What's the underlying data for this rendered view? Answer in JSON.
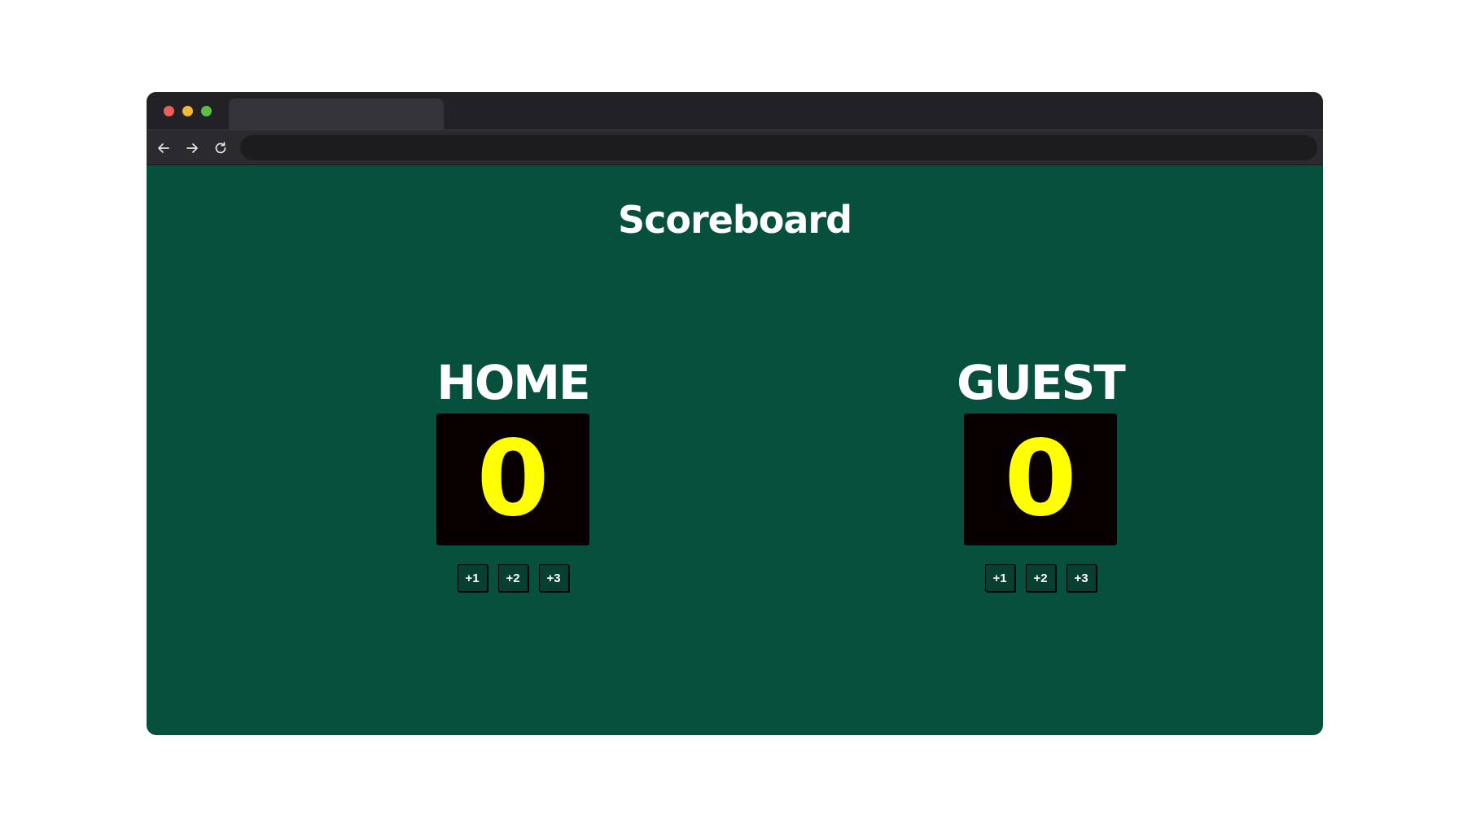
{
  "colors": {
    "page_background": "#07503d",
    "score_text": "#ffff00",
    "score_box": "#080000",
    "traffic_light_red": "#ee5f5a",
    "traffic_light_yellow": "#f3b73a",
    "traffic_light_green": "#5bbf45"
  },
  "browser": {
    "tab_title": "",
    "url": "",
    "icons": [
      "back-arrow-icon",
      "forward-arrow-icon",
      "reload-icon"
    ]
  },
  "page": {
    "title": "Scoreboard"
  },
  "home": {
    "name": "HOME",
    "score": "0",
    "buttons": [
      "+1",
      "+2",
      "+3"
    ]
  },
  "guest": {
    "name": "GUEST",
    "score": "0",
    "buttons": [
      "+1",
      "+2",
      "+3"
    ]
  }
}
